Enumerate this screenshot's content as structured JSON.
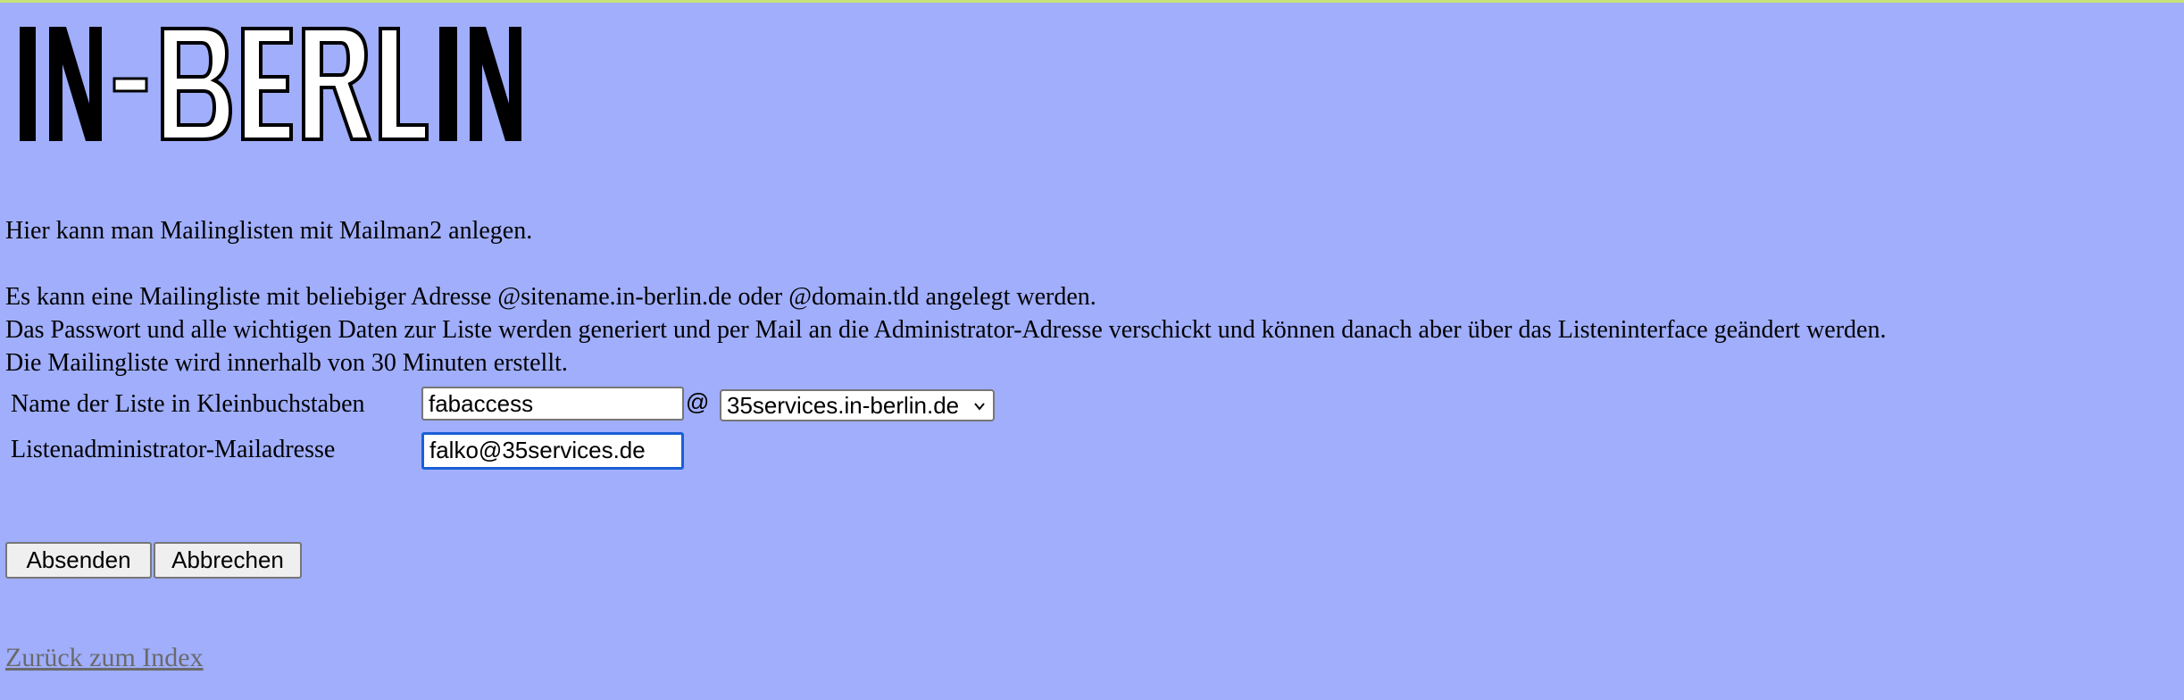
{
  "logo": {
    "text": "IN-BERLIN",
    "icon": "in-berlin-logo"
  },
  "intro": {
    "line1": "Hier kann man Mailinglisten mit Mailman2 anlegen.",
    "line2": "Es kann eine Mailingliste mit beliebiger Adresse @sitename.in-berlin.de oder @domain.tld angelegt werden.",
    "line3": "Das Passwort und alle wichtigen Daten zur Liste werden generiert und per Mail an die Administrator-Adresse verschickt und können danach aber über das Listeninterface geändert werden.",
    "line4": "Die Mailingliste wird innerhalb von 30 Minuten erstellt."
  },
  "form": {
    "list_name_label": "Name der Liste in Kleinbuchstaben",
    "list_name_value": "fabaccess",
    "at_sign": "@",
    "domain_selected": "35services.in-berlin.de",
    "admin_label": "Listenadministrator-Mailadresse",
    "admin_value": "falko@35services.de"
  },
  "buttons": {
    "submit": "Absenden",
    "cancel": "Abbrechen"
  },
  "back_link": "Zurück zum Index",
  "colors": {
    "background": "#a0aefc",
    "top_border": "#c7e37a",
    "focus": "#1a5fd6",
    "link": "#6a6a6a"
  }
}
